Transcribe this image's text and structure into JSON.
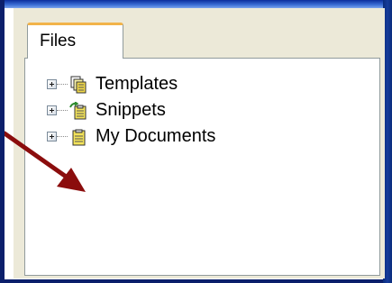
{
  "panel": {
    "tab_label": "Files"
  },
  "tree": {
    "items": [
      {
        "label": "Templates",
        "icon": "templates-folder-icon",
        "expander": "plus"
      },
      {
        "label": "Snippets",
        "icon": "snippets-folder-icon",
        "expander": "plus"
      },
      {
        "label": "My Documents",
        "icon": "documents-folder-icon",
        "expander": "plus"
      }
    ]
  },
  "colors": {
    "tab_accent": "#f2b34a",
    "arrow": "#8b0d0d",
    "window_frame": "#0b1f6b"
  }
}
